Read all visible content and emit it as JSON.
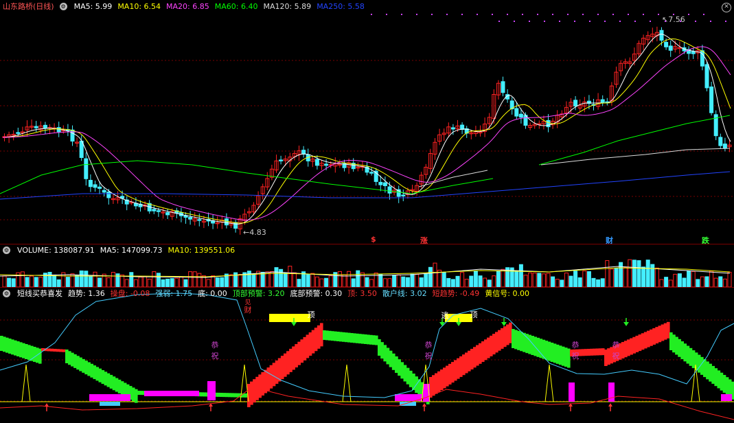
{
  "main": {
    "title": "山东路桥(日线)",
    "ma": [
      {
        "label": "MA5: 5.99",
        "color": "#ffffff"
      },
      {
        "label": "MA10: 6.54",
        "color": "#ffff00"
      },
      {
        "label": "MA20: 6.85",
        "color": "#ff44ff"
      },
      {
        "label": "MA60: 6.40",
        "color": "#00ff00"
      },
      {
        "label": "MA120: 5.89",
        "color": "#dddddd"
      },
      {
        "label": "MA250: 5.58",
        "color": "#2244ff"
      }
    ],
    "high_label": "7.56",
    "low_label": "4.83",
    "markers": [
      {
        "text": "$",
        "color": "#ff3333"
      },
      {
        "text": "涨",
        "color": "#ff3333"
      },
      {
        "text": "财",
        "color": "#3399ff"
      },
      {
        "text": "跌",
        "color": "#33ff33"
      }
    ]
  },
  "volume": {
    "items": [
      {
        "label": "VOLUME: 138087.91",
        "color": "#ffffff"
      },
      {
        "label": "MA5: 147099.73",
        "color": "#ffffff"
      },
      {
        "label": "MA10: 139551.06",
        "color": "#ffff00"
      }
    ]
  },
  "indicator": {
    "items": [
      {
        "label": "短线买恭喜发",
        "color": "#ffffff"
      },
      {
        "label": "趋势: 1.36",
        "color": "#ffffff"
      },
      {
        "label": "操盘: -0.08",
        "color": "#ff3333"
      },
      {
        "label": "强弱: 1.75",
        "color": "#66ddff"
      },
      {
        "label": "底: 0.00",
        "color": "#ffffff"
      },
      {
        "label": "顶部预警: 3.20",
        "color": "#33ff33"
      },
      {
        "label": "底部预警: 0.30",
        "color": "#ffffff"
      },
      {
        "label": "顶: 3.50",
        "color": "#ff3333"
      },
      {
        "label": "散户线: 3.02",
        "color": "#66ddff"
      },
      {
        "label": "短趋势: -0.49",
        "color": "#ff3333"
      },
      {
        "label": "黄信号: 0.00",
        "color": "#ffff00"
      }
    ],
    "labels": [
      {
        "text": "见",
        "color": "#ff3333"
      },
      {
        "text": "财",
        "color": "#ff3333"
      },
      {
        "text": "恭",
        "color": "#cc44cc"
      },
      {
        "text": "祝",
        "color": "#cc44cc"
      },
      {
        "text": "逃",
        "color": "#ffffff"
      },
      {
        "text": "顶",
        "color": "#ffffff"
      },
      {
        "text": "顶",
        "color": "#ffffff"
      },
      {
        "text": "恭",
        "color": "#cc44cc"
      },
      {
        "text": "祝",
        "color": "#cc44cc"
      },
      {
        "text": "恭",
        "color": "#cc44cc"
      },
      {
        "text": "祝",
        "color": "#cc44cc"
      },
      {
        "text": "恭",
        "color": "#cc44cc"
      },
      {
        "text": "祝",
        "color": "#cc44cc"
      }
    ]
  }
}
